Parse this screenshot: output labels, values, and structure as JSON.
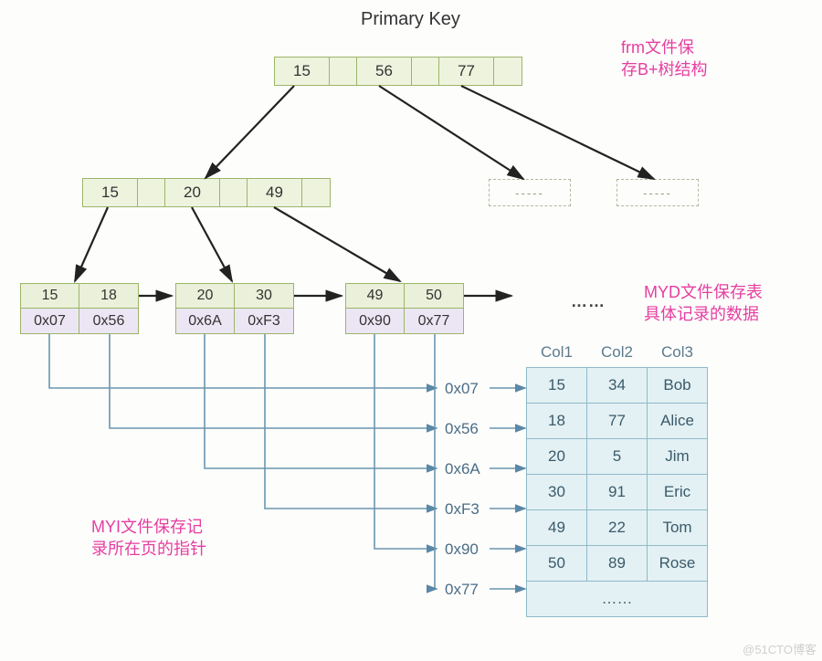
{
  "title": "Primary Key",
  "annotations": {
    "frm": "frm文件保\n存B+树结构",
    "myi": "MYI文件保存记\n录所在页的指针",
    "myd": "MYD文件保存表\n具体记录的数据"
  },
  "root": {
    "keys": [
      "15",
      "56",
      "77"
    ]
  },
  "internal": {
    "keys": [
      "15",
      "20",
      "49"
    ]
  },
  "leaves": [
    {
      "keys": [
        "15",
        "18"
      ],
      "ptrs": [
        "0x07",
        "0x56"
      ]
    },
    {
      "keys": [
        "20",
        "30"
      ],
      "ptrs": [
        "0x6A",
        "0xF3"
      ]
    },
    {
      "keys": [
        "49",
        "50"
      ],
      "ptrs": [
        "0x90",
        "0x77"
      ]
    }
  ],
  "ellipsis": "……",
  "pointer_labels": [
    "0x07",
    "0x56",
    "0x6A",
    "0xF3",
    "0x90",
    "0x77"
  ],
  "table": {
    "headers": [
      "Col1",
      "Col2",
      "Col3"
    ],
    "rows": [
      [
        "15",
        "34",
        "Bob"
      ],
      [
        "18",
        "77",
        "Alice"
      ],
      [
        "20",
        "5",
        "Jim"
      ],
      [
        "30",
        "91",
        "Eric"
      ],
      [
        "49",
        "22",
        "Tom"
      ],
      [
        "50",
        "89",
        "Rose"
      ]
    ],
    "extra_row": "……"
  },
  "watermark": "@51CTO博客"
}
